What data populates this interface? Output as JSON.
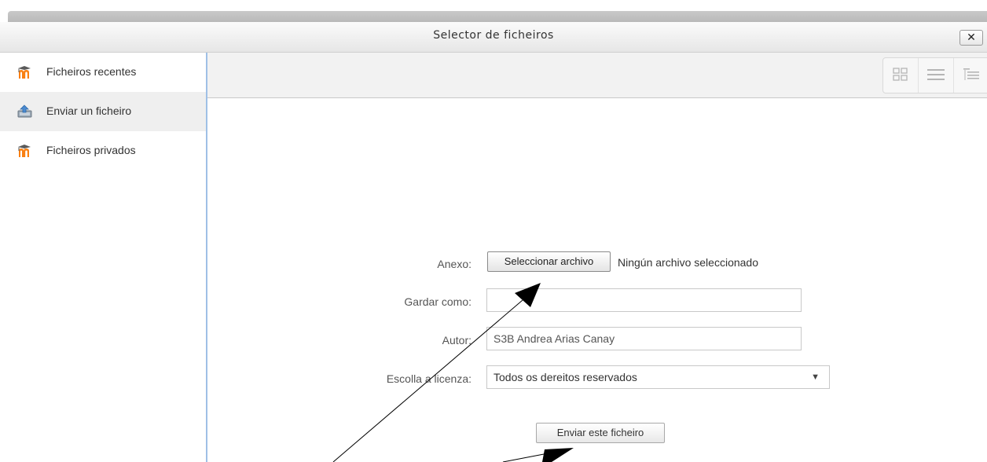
{
  "dialog": {
    "title": "Selector de ficheiros",
    "close_label": "✕"
  },
  "sidebar": {
    "items": [
      {
        "label": "Ficheiros recentes",
        "icon": "moodle-logo-icon",
        "active": false
      },
      {
        "label": "Enviar un ficheiro",
        "icon": "upload-icon",
        "active": true
      },
      {
        "label": "Ficheiros privados",
        "icon": "moodle-logo-icon",
        "active": false
      }
    ]
  },
  "toolbar": {
    "view_buttons": [
      "icons-view-icon",
      "list-view-icon",
      "tree-view-icon"
    ]
  },
  "form": {
    "attachment_label": "Anexo:",
    "choose_file_button": "Seleccionar archivo",
    "file_status": "Ningún archivo seleccionado",
    "save_as_label": "Gardar como:",
    "save_as_value": "",
    "author_label": "Autor:",
    "author_value": "S3B Andrea Arias Canay",
    "license_label": "Escolla a licenza:",
    "license_value": "Todos os dereitos reservados",
    "submit_button": "Enviar este ficheiro"
  },
  "colors": {
    "moodle_orange": "#f98012",
    "sidebar_border": "#9fc0e6",
    "active_item_bg": "#efefef"
  }
}
